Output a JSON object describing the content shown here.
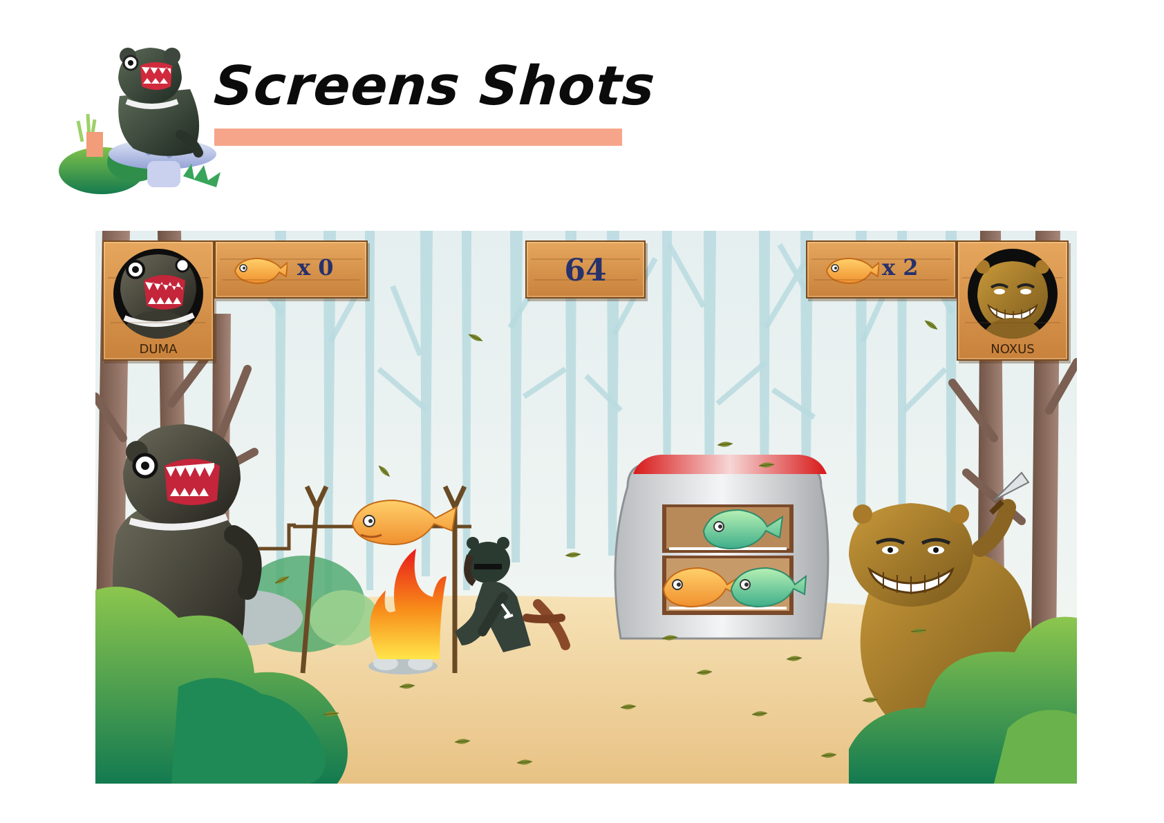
{
  "page": {
    "title": "Screens Shots",
    "underline_color": "#f6a58a"
  },
  "game": {
    "left_player": {
      "name": "DUMA",
      "fish_label": "x 0",
      "fish_count": 0,
      "portrait_icon": "black-bear-icon"
    },
    "right_player": {
      "name": "NOXUS",
      "fish_label": "x 2",
      "fish_count": 2,
      "portrait_icon": "brown-bear-icon"
    },
    "timer": "64",
    "colors": {
      "plank": "#d79548",
      "counter_text": "#27316b",
      "sky": "#e9f2f1",
      "ground": "#f0d49e"
    }
  }
}
